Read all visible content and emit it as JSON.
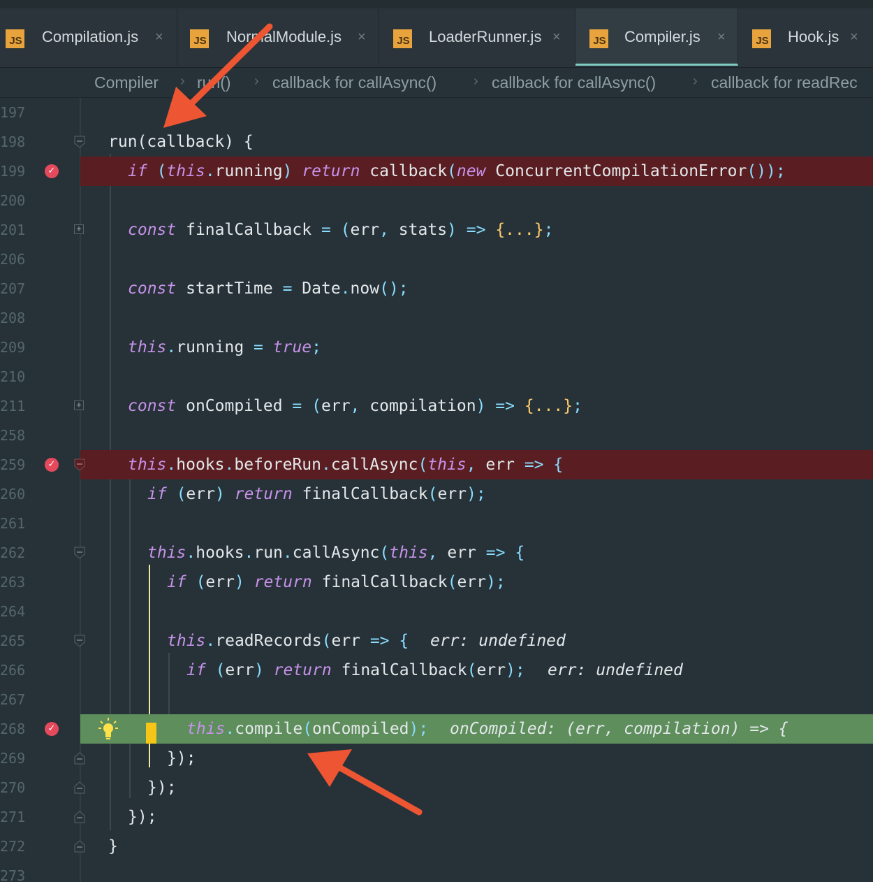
{
  "tabs": [
    {
      "icon": "JS",
      "label": "Compilation.js",
      "close": "×"
    },
    {
      "icon": "JS",
      "label": "NormalModule.js",
      "close": "×"
    },
    {
      "icon": "JS",
      "label": "LoaderRunner.js",
      "close": "×"
    },
    {
      "icon": "JS",
      "label": "Compiler.js",
      "close": "×"
    },
    {
      "icon": "JS",
      "label": "Hook.js",
      "close": "×"
    }
  ],
  "active_tab": "Compiler.js",
  "breadcrumb": {
    "items": [
      "Compiler",
      "run()",
      "callback for callAsync()",
      "callback for callAsync()",
      "callback for readRec"
    ],
    "separator": "›"
  },
  "breakpoint_glyph": "✓",
  "colors": {
    "error_line": "#5a1e22",
    "execution_line": "#5e8e5c",
    "annotation_arrow": "#ee5533"
  },
  "lines": [
    {
      "n": "197",
      "text": ""
    },
    {
      "n": "198",
      "text": "run(callback) {"
    },
    {
      "n": "199",
      "text": "if (this.running) return callback(new ConcurrentCompilationError());"
    },
    {
      "n": "200",
      "text": ""
    },
    {
      "n": "201",
      "text": "const finalCallback = (err, stats) => {...};"
    },
    {
      "n": "206",
      "text": ""
    },
    {
      "n": "207",
      "text": "const startTime = Date.now();"
    },
    {
      "n": "208",
      "text": ""
    },
    {
      "n": "209",
      "text": "this.running = true;"
    },
    {
      "n": "210",
      "text": ""
    },
    {
      "n": "211",
      "text": "const onCompiled = (err, compilation) => {...};"
    },
    {
      "n": "258",
      "text": ""
    },
    {
      "n": "259",
      "text": "this.hooks.beforeRun.callAsync(this, err => {"
    },
    {
      "n": "260",
      "text": "if (err) return finalCallback(err);"
    },
    {
      "n": "261",
      "text": ""
    },
    {
      "n": "262",
      "text": "this.hooks.run.callAsync(this, err => {"
    },
    {
      "n": "263",
      "text": "if (err) return finalCallback(err);"
    },
    {
      "n": "264",
      "text": ""
    },
    {
      "n": "265",
      "text": "this.readRecords(err => {",
      "hint": "err: undefined"
    },
    {
      "n": "266",
      "text": "if (err) return finalCallback(err);",
      "hint": "err: undefined"
    },
    {
      "n": "267",
      "text": ""
    },
    {
      "n": "268",
      "text": "this.compile(onCompiled);",
      "hint": "onCompiled: (err, compilation) => {"
    },
    {
      "n": "269",
      "text": "});"
    },
    {
      "n": "270",
      "text": "});"
    },
    {
      "n": "271",
      "text": "});"
    },
    {
      "n": "272",
      "text": "}"
    },
    {
      "n": "273",
      "text": ""
    }
  ]
}
